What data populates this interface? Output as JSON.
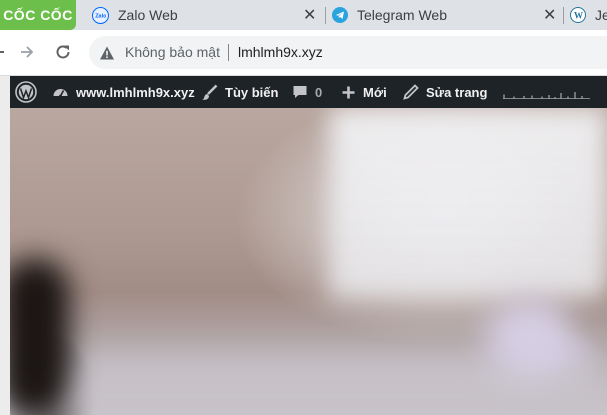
{
  "browser": {
    "logo_text": "CỐC CỐC",
    "tabs": [
      {
        "title": "Zalo Web",
        "icon": "zalo-icon",
        "close": "✕"
      },
      {
        "title": "Telegram Web",
        "icon": "telegram-icon",
        "close": "✕"
      },
      {
        "title": "Je",
        "icon": "wordpress-icon"
      }
    ],
    "omnibox": {
      "security_text": "Không bảo mật",
      "url": "lmhlmh9x.xyz"
    }
  },
  "adminbar": {
    "site_name": "www.lmhlmh9x.xyz",
    "customize_label": "Tùy biến",
    "comments_count": "0",
    "new_label": "Mới",
    "edit_label": "Sửa trang"
  },
  "colors": {
    "logo_green": "#6dbf4b",
    "tabstrip": "#dee1e6",
    "adminbar": "#1d2327",
    "telegram_blue": "#2aa3df",
    "zalo_blue": "#0068ff"
  }
}
